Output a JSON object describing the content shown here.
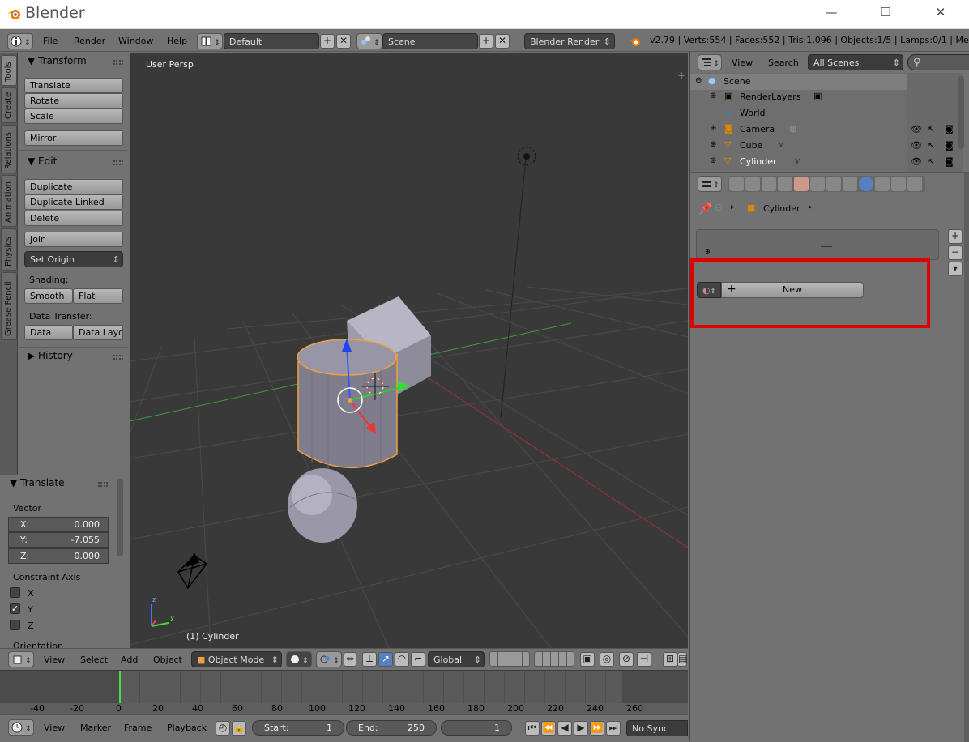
{
  "window": {
    "title": "Blender",
    "min": "—",
    "max": "☐",
    "close": "✕"
  },
  "infobar": {
    "menus": [
      "File",
      "Render",
      "Window",
      "Help"
    ],
    "layout": "Default",
    "scene": "Scene",
    "engine": "Blender Render",
    "stats": "v2.79 | Verts:554 | Faces:552 | Tris:1,096 | Objects:1/5 | Lamps:0/1 | Mem:15"
  },
  "tabs": [
    "Tools",
    "Create",
    "Relations",
    "Animation",
    "Physics",
    "Grease Pencil"
  ],
  "toolshelf": {
    "transform_header": "Transform",
    "translate": "Translate",
    "rotate": "Rotate",
    "scale": "Scale",
    "mirror": "Mirror",
    "edit_header": "Edit",
    "duplicate": "Duplicate",
    "duplicate_linked": "Duplicate Linked",
    "delete": "Delete",
    "join": "Join",
    "set_origin": "Set Origin",
    "shading_label": "Shading:",
    "smooth": "Smooth",
    "flat": "Flat",
    "data_transfer_label": "Data Transfer:",
    "data": "Data",
    "data_layout": "Data Layo",
    "history_header": "History"
  },
  "redo": {
    "header": "Translate",
    "vector_label": "Vector",
    "x_label": "X:",
    "x_value": "0.000",
    "y_label": "Y:",
    "y_value": "-7.055",
    "z_label": "Z:",
    "z_value": "0.000",
    "constraint_label": "Constraint Axis",
    "cx": "X",
    "cy": "Y",
    "cz": "Z",
    "orientation_label": "Orientation"
  },
  "viewport": {
    "view_name": "User Persp",
    "object_label": "(1) Cylinder",
    "axis_z": "z",
    "axis_y": "y"
  },
  "v3d_header": {
    "menus": [
      "View",
      "Select",
      "Add",
      "Object"
    ],
    "mode": "Object Mode",
    "orientation": "Global"
  },
  "timeline": {
    "ticks": [
      "-40",
      "-20",
      "0",
      "20",
      "40",
      "60",
      "80",
      "100",
      "120",
      "140",
      "160",
      "180",
      "200",
      "220",
      "240",
      "260"
    ]
  },
  "timeline_header": {
    "menus": [
      "View",
      "Marker",
      "Frame",
      "Playback"
    ],
    "start_label": "Start:",
    "start_value": "1",
    "end_label": "End:",
    "end_value": "250",
    "current_frame": "1",
    "sync": "No Sync"
  },
  "outliner": {
    "menus": [
      "View",
      "Search"
    ],
    "filter": "All Scenes",
    "rows": [
      "Scene",
      "RenderLayers",
      "World",
      "Camera",
      "Cube",
      "Cylinder"
    ]
  },
  "properties": {
    "breadcrumb_object": "Cylinder",
    "new_button": "New"
  },
  "colors": {
    "highlight": "#e00000",
    "selected_orange": "#f0a040",
    "viewport_bg": "#393939",
    "panel_bg": "#727272"
  }
}
